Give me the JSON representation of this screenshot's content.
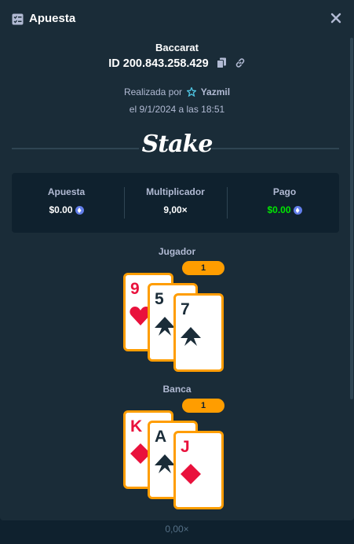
{
  "header": {
    "title": "Apuesta",
    "icon": "bet-slip-icon",
    "close_icon": "close-icon"
  },
  "bet": {
    "game": "Baccarat",
    "id": "ID 200.843.258.429",
    "placed_by_prefix": "Realizada por",
    "user": "Yazmil",
    "date": "el 9/1/2024 a las 18:51"
  },
  "brand": {
    "logo_text": "Stake"
  },
  "stats": {
    "bet_label": "Apuesta",
    "bet_value": "$0.00",
    "multiplier_label": "Multiplicador",
    "multiplier_value": "9,00×",
    "payout_label": "Pago",
    "payout_value": "$0.00",
    "currency_icon": "eth-icon"
  },
  "player": {
    "label": "Jugador",
    "score": "1",
    "cards": [
      {
        "rank": "9",
        "suit": "hearts",
        "color": "red"
      },
      {
        "rank": "5",
        "suit": "spades",
        "color": "black"
      },
      {
        "rank": "7",
        "suit": "spades",
        "color": "black"
      }
    ]
  },
  "banker": {
    "label": "Banca",
    "score": "1",
    "cards": [
      {
        "rank": "K",
        "suit": "diamonds",
        "color": "red"
      },
      {
        "rank": "A",
        "suit": "spades",
        "color": "black"
      },
      {
        "rank": "J",
        "suit": "diamonds",
        "color": "red"
      }
    ]
  },
  "footer": {
    "multiplier": "0,00×"
  },
  "colors": {
    "accent": "#ff9d00",
    "win": "#00e701",
    "panel": "#1a2c38",
    "background": "#0f212e",
    "red_suit": "#e9113c"
  }
}
